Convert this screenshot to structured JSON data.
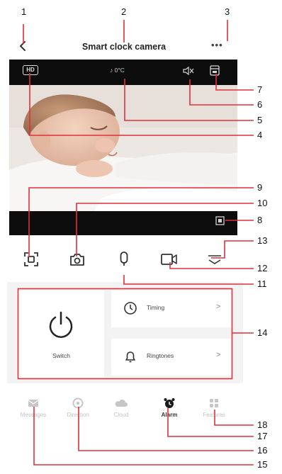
{
  "header": {
    "title": "Smart clock camera",
    "more_label": "•••"
  },
  "video": {
    "quality_badge": "HD",
    "temperature": "♪ 0°C"
  },
  "controls": {
    "switch_label": "Switch",
    "timing_label": "Timing",
    "ringtones_label": "Ringtones",
    "chevron": ">"
  },
  "nav": {
    "items": [
      {
        "label": "Messages",
        "icon": "messages-icon"
      },
      {
        "label": "Direction",
        "icon": "direction-icon"
      },
      {
        "label": "Cloud",
        "icon": "cloud-icon"
      },
      {
        "label": "Alarm",
        "icon": "alarm-icon"
      },
      {
        "label": "Features",
        "icon": "features-icon"
      }
    ]
  },
  "callouts": {
    "n1": "1",
    "n2": "2",
    "n3": "3",
    "n4": "4",
    "n5": "5",
    "n6": "6",
    "n7": "7",
    "n8": "8",
    "n9": "9",
    "n10": "10",
    "n11": "11",
    "n12": "12",
    "n13": "13",
    "n14": "14",
    "n15": "15",
    "n16": "16",
    "n17": "17",
    "n18": "18"
  },
  "colors": {
    "callout": "#e0303a",
    "video_bar": "#0d0d0d",
    "panel_bg": "#f3f3f3"
  }
}
